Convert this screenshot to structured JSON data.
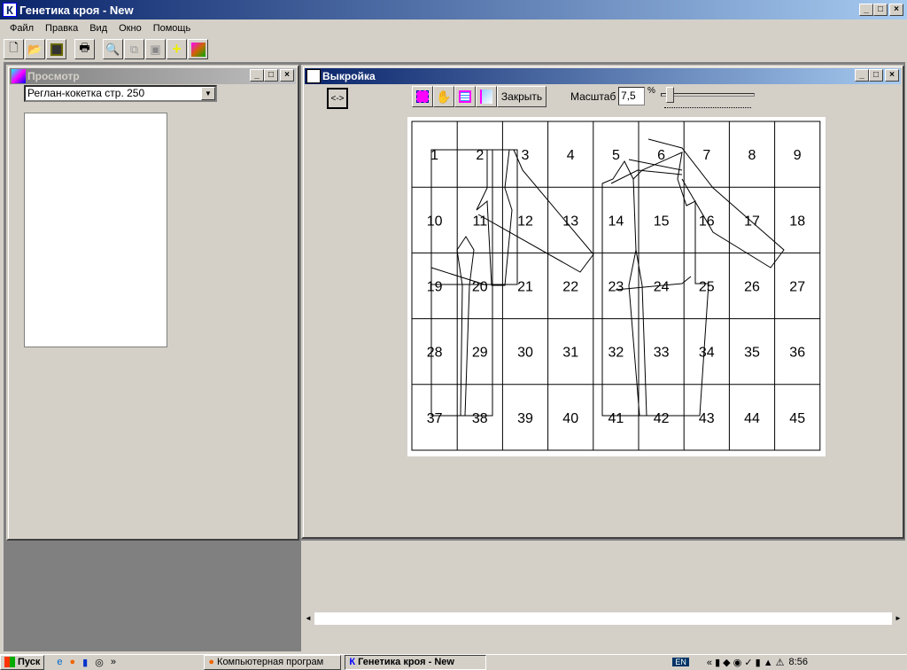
{
  "app": {
    "title": "Генетика кроя - New",
    "icon_letter": "К"
  },
  "menu": [
    "Файл",
    "Правка",
    "Вид",
    "Окно",
    "Помощь"
  ],
  "toolbar": [
    "new-icon",
    "open-icon",
    "save-icon",
    "print-icon",
    "preview-icon",
    "copy-icon",
    "paste-icon",
    "cross-icon",
    "people-icon"
  ],
  "preview": {
    "title": "Просмотр",
    "combo_value": "Реглан-кокетка стр. 250"
  },
  "pattern": {
    "title": "Выкройка",
    "nav_label": "<->",
    "close_label": "Закрыть",
    "scale_label": "Масштаб",
    "scale_value": "7,5",
    "percent": "%",
    "cells": [
      "1",
      "2",
      "3",
      "4",
      "5",
      "6",
      "7",
      "8",
      "9",
      "10",
      "11",
      "12",
      "13",
      "14",
      "15",
      "16",
      "17",
      "18",
      "19",
      "20",
      "21",
      "22",
      "23",
      "24",
      "25",
      "26",
      "27",
      "28",
      "29",
      "30",
      "31",
      "32",
      "33",
      "34",
      "35",
      "36",
      "37",
      "38",
      "39",
      "40",
      "41",
      "42",
      "43",
      "44",
      "45"
    ]
  },
  "taskbar": {
    "start": "Пуск",
    "tasks": [
      "Компьютерная програм",
      "Генетика кроя - New"
    ],
    "lang": "EN",
    "clock": "8:56",
    "chevron": "»"
  },
  "colors": {
    "title_active": "#0a246a",
    "face": "#d4d0c8",
    "mdi": "#808080"
  }
}
